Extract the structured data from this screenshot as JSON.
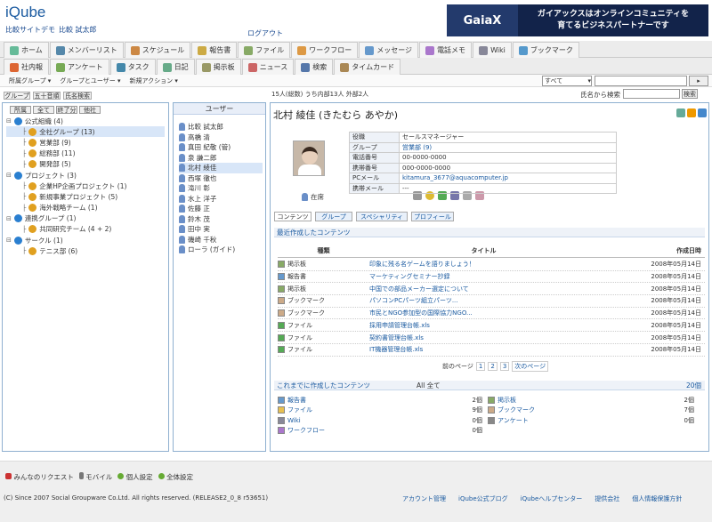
{
  "header": {
    "logo": "iQube",
    "site_name": "比較サイトデモ",
    "user_name": "比較 試太郎",
    "logout": "ログアウト",
    "banner": {
      "brand": "GaiaX",
      "line1": "ガイアックスはオンラインコミュニティを",
      "line2": "育てるビジネスパートナーです",
      "tag": "Empowering the people to connect"
    }
  },
  "tabs_row1": [
    {
      "label": "ホーム",
      "icon": "home-icon"
    },
    {
      "label": "メンバーリスト",
      "icon": "members-icon"
    },
    {
      "label": "スケジュール",
      "icon": "schedule-icon"
    },
    {
      "label": "報告書",
      "icon": "report-icon"
    },
    {
      "label": "ファイル",
      "icon": "file-icon"
    },
    {
      "label": "ワークフロー",
      "icon": "workflow-icon"
    },
    {
      "label": "メッセージ",
      "icon": "message-icon"
    },
    {
      "label": "電話メモ",
      "icon": "phone-memo-icon"
    },
    {
      "label": "Wiki",
      "icon": "wiki-icon"
    },
    {
      "label": "ブックマーク",
      "icon": "bookmark-icon"
    }
  ],
  "tabs_row2": [
    {
      "label": "社内報",
      "icon": "newsletter-icon"
    },
    {
      "label": "アンケート",
      "icon": "survey-icon"
    },
    {
      "label": "タスク",
      "icon": "task-icon"
    },
    {
      "label": "日記",
      "icon": "diary-icon"
    },
    {
      "label": "掲示板",
      "icon": "board-icon"
    },
    {
      "label": "ニュース",
      "icon": "news-icon"
    },
    {
      "label": "検索",
      "icon": "search-icon"
    },
    {
      "label": "タイムカード",
      "icon": "timecard-icon"
    }
  ],
  "menubar": {
    "items": [
      "所属グループ ▾",
      "グループとユーザー ▾",
      "新規アクション ▾"
    ],
    "filter": "すべて",
    "search_label": "氏名から検索",
    "search_button": "検索"
  },
  "left": {
    "tabs": [
      "グループ",
      "五十音順",
      "氏名検索"
    ],
    "subtabs": [
      "所属",
      "全て",
      "終了分",
      "他社"
    ],
    "tree": [
      {
        "label": "公式組織 (4)",
        "lvl": 0,
        "t": "bl"
      },
      {
        "label": "全社グループ (13)",
        "lvl": 1,
        "t": "gi",
        "sel": true
      },
      {
        "label": "営業部 (9)",
        "lvl": 1,
        "t": "gi"
      },
      {
        "label": "総務部 (11)",
        "lvl": 1,
        "t": "gi"
      },
      {
        "label": "開発部 (5)",
        "lvl": 1,
        "t": "gi"
      },
      {
        "label": "プロジェクト (3)",
        "lvl": 0,
        "t": "bl"
      },
      {
        "label": "企業HP企画プロジェクト (1)",
        "lvl": 1,
        "t": "gi"
      },
      {
        "label": "新規事業プロジェクト (5)",
        "lvl": 1,
        "t": "gi"
      },
      {
        "label": "海外戦略チーム (1)",
        "lvl": 1,
        "t": "gi"
      },
      {
        "label": "連携グループ (1)",
        "lvl": 0,
        "t": "bl"
      },
      {
        "label": "共同研究チーム (4 + 2)",
        "lvl": 1,
        "t": "gi"
      },
      {
        "label": "サークル (1)",
        "lvl": 0,
        "t": "bl"
      },
      {
        "label": "テニス部 (6)",
        "lvl": 1,
        "t": "gi"
      }
    ]
  },
  "users": {
    "count_text": "15人(総数) うち内部13人 外部2人",
    "header": "ユーザー",
    "list": [
      "比較 試太郎",
      "高橋 清",
      "真田 紀敬 (管)",
      "泉 謙二郎",
      "北村 綾佳",
      "西塚 徹也",
      "滝川 彰",
      "水上 洋子",
      "佐藤 正",
      "鈴木 茂",
      "田中 実",
      "磯崎 千秋",
      "ローラ (ガイド)"
    ],
    "selected": 4
  },
  "profile": {
    "name": "北村 綾佳 (きたむら あやか)",
    "status": "在席",
    "fields": [
      {
        "k": "役職",
        "v": "セールスマネージャー"
      },
      {
        "k": "グループ",
        "v": "営業部 (9)"
      },
      {
        "k": "電話番号",
        "v": "00-0000-0000"
      },
      {
        "k": "携帯番号",
        "v": "000-0000-0000"
      },
      {
        "k": "PCメール",
        "v": "kitamura_3677@aquacomputer.jp"
      },
      {
        "k": "携帯メール",
        "v": "---"
      }
    ]
  },
  "content_tabs": [
    "コンテンツ",
    "グループ",
    "スペシャリティ",
    "プロフィール"
  ],
  "recent": {
    "title": "最近作成したコンテンツ",
    "col_type": "種類",
    "col_title": "タイトル",
    "col_date": "作成日時",
    "rows": [
      {
        "type": "掲示板",
        "title": "印象に残る名ゲームを語りましょう！",
        "date": "2008年05月14日"
      },
      {
        "type": "報告書",
        "title": "マーケティングセミナー抄録",
        "date": "2008年05月14日"
      },
      {
        "type": "掲示板",
        "title": "中国での部品メーカー選定について",
        "date": "2008年05月14日"
      },
      {
        "type": "ブックマーク",
        "title": "パソコンPCパーツ組立パーツ...",
        "date": "2008年05月14日"
      },
      {
        "type": "ブックマーク",
        "title": "市民とNGO参加型の国際協力NGO...",
        "date": "2008年05月14日"
      },
      {
        "type": "ファイル",
        "title": "採用申請管理台帳.xls",
        "date": "2008年05月14日"
      },
      {
        "type": "ファイル",
        "title": "契約書管理台帳.xls",
        "date": "2008年05月14日"
      },
      {
        "type": "ファイル",
        "title": "IT機器管理台帳.xls",
        "date": "2008年05月14日"
      }
    ],
    "pager": {
      "prev": "前のページ",
      "pages": [
        "1",
        "2",
        "3"
      ],
      "next": "次のページ"
    }
  },
  "summary": {
    "title": "これまでに作成したコンテンツ",
    "all_label": "All 全て",
    "total": "20個",
    "left": [
      {
        "label": "報告書",
        "n": "2個"
      },
      {
        "label": "ファイル",
        "n": "9個"
      },
      {
        "label": "Wiki",
        "n": "0個"
      },
      {
        "label": "ワークフロー",
        "n": "0個"
      }
    ],
    "right": [
      {
        "label": "掲示板",
        "n": "2個"
      },
      {
        "label": "ブックマーク",
        "n": "7個"
      },
      {
        "label": "アンケート",
        "n": "0個"
      }
    ]
  },
  "footer": {
    "links1": [
      "みんなのリクエスト",
      "モバイル",
      "個人設定",
      "全体設定"
    ],
    "copyright": "(C) Since 2007 Social Groupware Co.Ltd. All rights reserved. (RELEASE2_0_8 r53651)",
    "links2": [
      "アカウント管理",
      "iQube公式ブログ",
      "iQubeヘルプセンター",
      "提供会社",
      "個人情報保護方針"
    ]
  }
}
